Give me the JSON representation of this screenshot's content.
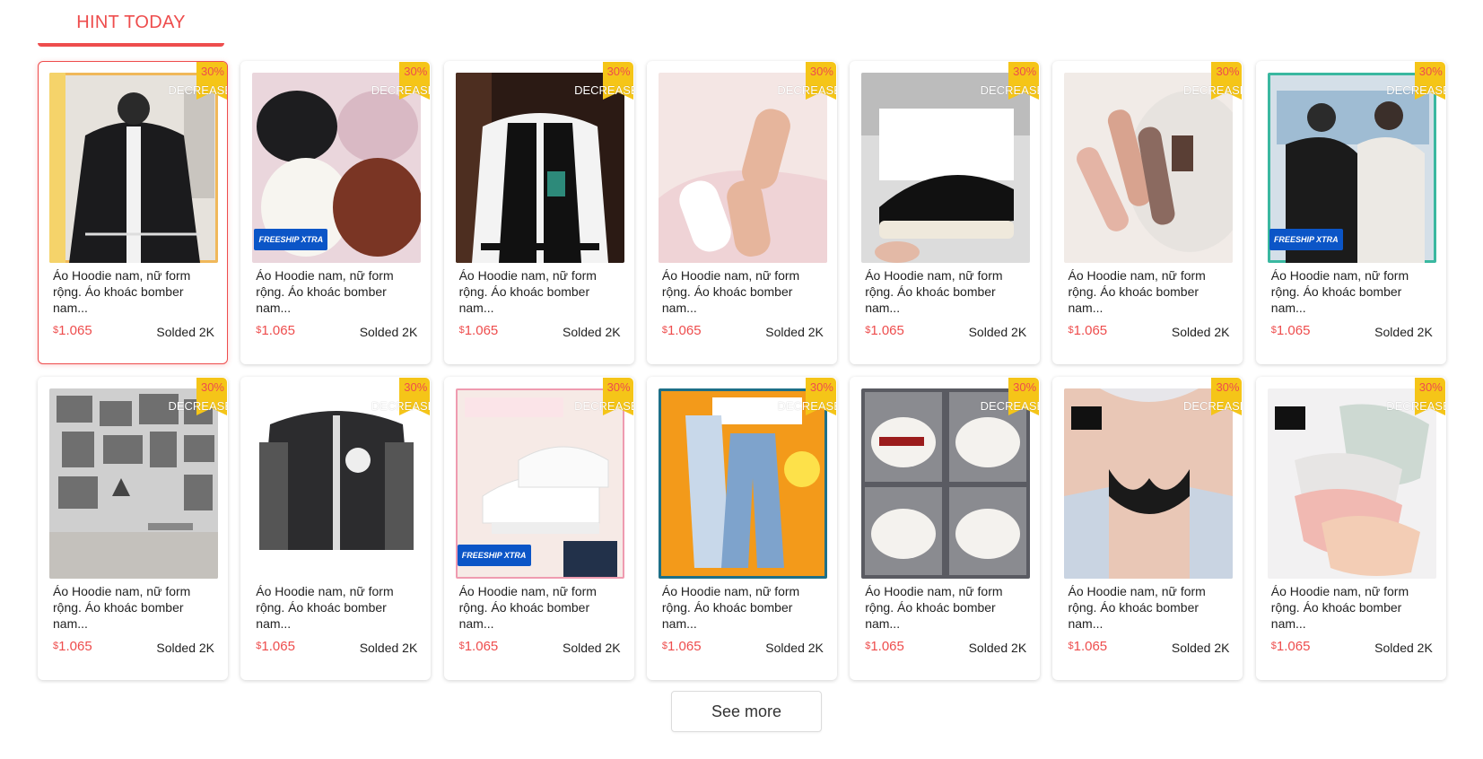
{
  "section": {
    "title": "HINT TODAY",
    "accent": "#ee4d4d"
  },
  "see_more_label": "See more",
  "products": [
    {
      "title": "Áo Hoodie nam, nữ form rộng. Áo khoác bomber nam...",
      "currency": "$",
      "price": "1.065",
      "sold": "Solded 2K",
      "discount": "30%",
      "discount_label": "DECREASE",
      "badge": "",
      "image": "black-baseball-jacket-icon",
      "selected": true
    },
    {
      "title": "Áo Hoodie nam, nữ form rộng. Áo khoác bomber nam...",
      "currency": "$",
      "price": "1.065",
      "sold": "Solded 2K",
      "discount": "30%",
      "discount_label": "DECREASE",
      "badge": "FREESHIP XTRA",
      "image": "fluffy-hoodies-icon",
      "selected": false
    },
    {
      "title": "Áo Hoodie nam, nữ form rộng. Áo khoác bomber nam...",
      "currency": "$",
      "price": "1.065",
      "sold": "Solded 2K",
      "discount": "30%",
      "discount_label": "DECREASE",
      "badge": "",
      "image": "varsity-jacket-icon",
      "selected": false
    },
    {
      "title": "Áo Hoodie nam, nữ form rộng. Áo khoác bomber nam...",
      "currency": "$",
      "price": "1.065",
      "sold": "Solded 2K",
      "discount": "30%",
      "discount_label": "DECREASE",
      "badge": "",
      "image": "sandals-icon",
      "selected": false
    },
    {
      "title": "Áo Hoodie nam, nữ form rộng. Áo khoác bomber nam...",
      "currency": "$",
      "price": "1.065",
      "sold": "Solded 2K",
      "discount": "30%",
      "discount_label": "DECREASE",
      "badge": "",
      "image": "sneaker-slip-on-icon",
      "selected": false
    },
    {
      "title": "Áo Hoodie nam, nữ form rộng. Áo khoác bomber nam...",
      "currency": "$",
      "price": "1.065",
      "sold": "Solded 2K",
      "discount": "30%",
      "discount_label": "DECREASE",
      "badge": "",
      "image": "press-on-nails-icon",
      "selected": false
    },
    {
      "title": "Áo Hoodie nam, nữ form rộng. Áo khoác bomber nam...",
      "currency": "$",
      "price": "1.065",
      "sold": "Solded 2K",
      "discount": "30%",
      "discount_label": "DECREASE",
      "badge": "FREESHIP XTRA",
      "image": "couple-tshirts-icon",
      "selected": false
    },
    {
      "title": "Áo Hoodie nam, nữ form rộng. Áo khoác bomber nam...",
      "currency": "$",
      "price": "1.065",
      "sold": "Solded 2K",
      "discount": "30%",
      "discount_label": "DECREASE",
      "badge": "",
      "image": "manga-wallpaper-icon",
      "selected": false
    },
    {
      "title": "Áo Hoodie nam, nữ form rộng. Áo khoác bomber nam...",
      "currency": "$",
      "price": "1.065",
      "sold": "Solded 2K",
      "discount": "30%",
      "discount_label": "DECREASE",
      "badge": "",
      "image": "grey-bomber-jacket-icon",
      "selected": false
    },
    {
      "title": "Áo Hoodie nam, nữ form rộng. Áo khoác bomber nam...",
      "currency": "$",
      "price": "1.065",
      "sold": "Solded 2K",
      "discount": "30%",
      "discount_label": "DECREASE",
      "badge": "FREESHIP XTRA",
      "image": "white-sneakers-icon",
      "selected": false
    },
    {
      "title": "Áo Hoodie nam, nữ form rộng. Áo khoác bomber nam...",
      "currency": "$",
      "price": "1.065",
      "sold": "Solded 2K",
      "discount": "30%",
      "discount_label": "DECREASE",
      "badge": "",
      "image": "jeans-icon",
      "selected": false
    },
    {
      "title": "Áo Hoodie nam, nữ form rộng. Áo khoác bomber nam...",
      "currency": "$",
      "price": "1.065",
      "sold": "Solded 2K",
      "discount": "30%",
      "discount_label": "DECREASE",
      "badge": "",
      "image": "chunky-sneakers-icon",
      "selected": false
    },
    {
      "title": "Áo Hoodie nam, nữ form rộng. Áo khoác bomber nam...",
      "currency": "$",
      "price": "1.065",
      "sold": "Solded 2K",
      "discount": "30%",
      "discount_label": "DECREASE",
      "badge": "",
      "image": "bikini-top-icon",
      "selected": false
    },
    {
      "title": "Áo Hoodie nam, nữ form rộng. Áo khoác bomber nam...",
      "currency": "$",
      "price": "1.065",
      "sold": "Solded 2K",
      "discount": "30%",
      "discount_label": "DECREASE",
      "badge": "",
      "image": "underwear-set-icon",
      "selected": false
    }
  ],
  "colors": {
    "price": "#ee4d4d",
    "ribbon": "#f5c518",
    "freeship": "#0b55c7"
  }
}
